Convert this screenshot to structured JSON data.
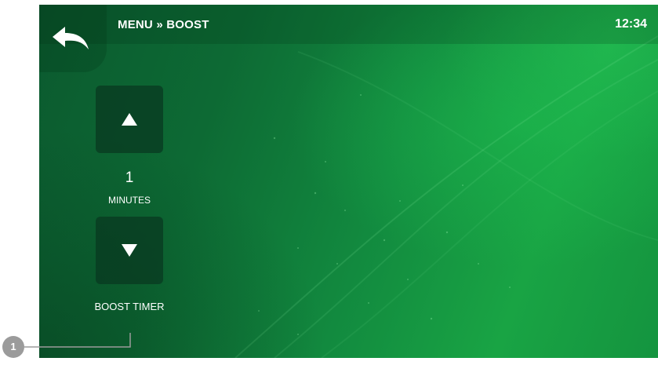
{
  "header": {
    "breadcrumb": "MENU » BOOST",
    "time": "12:34"
  },
  "controls": {
    "value": "1",
    "unit": "MINUTES",
    "label": "BOOST TIMER"
  },
  "annotation": {
    "number": "1"
  },
  "colors": {
    "background_dark": "#0b5a2f",
    "background_light": "#19a444",
    "button_fill": "#08371f",
    "callout_gray": "#9b9b9b",
    "text": "#ffffff"
  },
  "icons": {
    "back": "back-arrow-icon",
    "up": "triangle-up-icon",
    "down": "triangle-down-icon"
  }
}
